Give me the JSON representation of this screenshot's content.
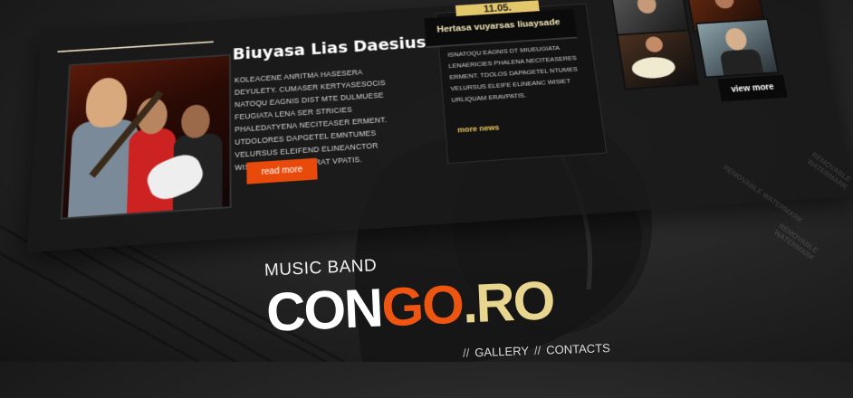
{
  "feature": {
    "title": "Biuyasa Lias Daesiusha",
    "body": "KOLEACENE ANRITMA HASESERA DEYULETY. CUMASER KERTYASESOCIS NATOQU EAGNIS DIST MTE DULMUESE FEUGIATA LENA SER STRICIES PHALEDATYENA NECITEASER ERMENT. UTDOLORES DAPGETEL EMNTUMES VELURSUS ELEIFEND ELINEANCTOR WISIET URLIQUAM ERAT VPATIS.",
    "read_more": "read more"
  },
  "news": {
    "date": "11.05.",
    "headline": "Hertasa vuyarsas liuaysade",
    "body": "ISNATOQU EAGNIS DT MIUEUGIATA LENAERICIES PHALENA NECITEASERES ERMENT. TDOLOS DAPAGETEL NTUMES VELURSUS ELEIFE ELINEANC WISIET URLIQUAM ERAVPATIS.",
    "more": "more news"
  },
  "gallery": {
    "view_more": "view more"
  },
  "brand": {
    "tagline": "MUSIC BAND",
    "logo_part1": "CON",
    "logo_part2": "GO",
    "logo_part3": ".RO",
    "colors": {
      "orange": "#ee5511",
      "gold": "#e9d68e",
      "white": "#ffffff"
    }
  },
  "nav": {
    "items": [
      "GALLERY",
      "CONTACTS"
    ],
    "separator": "//"
  },
  "watermark": "REMOVABLE WATERMARK"
}
